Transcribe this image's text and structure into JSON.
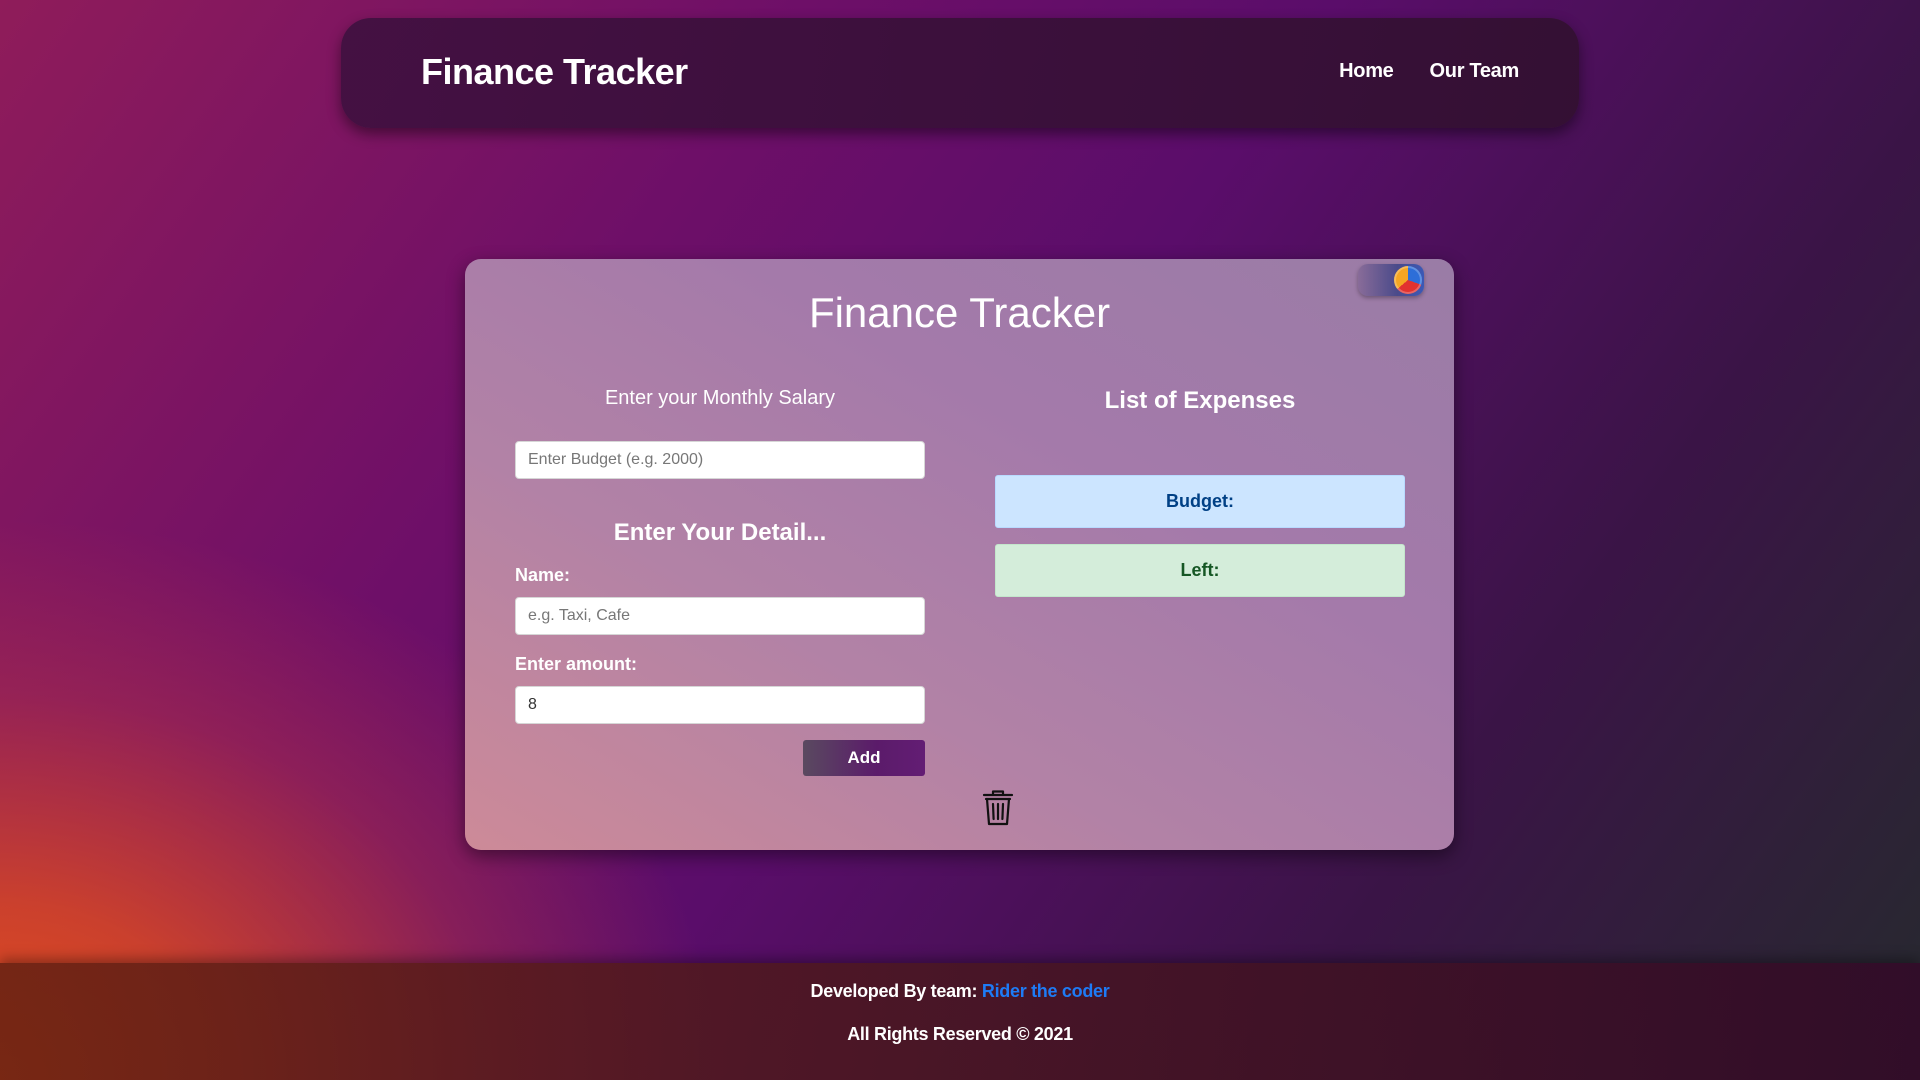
{
  "navbar": {
    "brand": "Finance Tracker",
    "links": [
      {
        "label": "Home"
      },
      {
        "label": "Our Team"
      }
    ]
  },
  "card": {
    "title": "Finance Tracker",
    "theme_toggle_icon": "pie-chart-icon",
    "salary": {
      "label": "Enter your Monthly Salary",
      "placeholder": "Enter Budget (e.g. 2000)",
      "value": ""
    },
    "detail": {
      "heading": "Enter Your Detail...",
      "name_label": "Name:",
      "name_placeholder": "e.g. Taxi, Cafe",
      "name_value": "",
      "amount_label": "Enter amount:",
      "amount_value": "8",
      "add_label": "Add",
      "delete_icon": "trash-icon"
    },
    "expenses": {
      "heading": "List of Expenses",
      "budget_label": "Budget:",
      "left_label": "Left:"
    }
  },
  "footer": {
    "developed_prefix": "Developed By team:",
    "team_link": "Rider the coder",
    "rights": "All Rights Reserved © 2021"
  },
  "colors": {
    "budget_box_bg": "#cce5ff",
    "left_box_bg": "#d4edda",
    "link": "#1e7bf5"
  }
}
